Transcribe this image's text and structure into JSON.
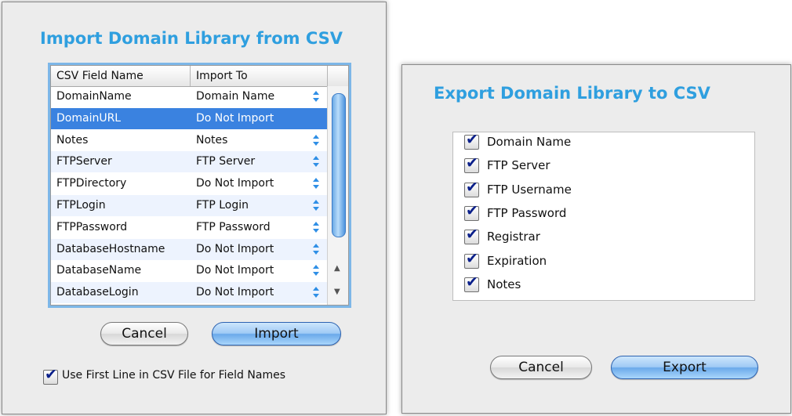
{
  "import_dialog": {
    "title": "Import Domain Library from CSV",
    "columns": [
      "CSV Field Name",
      "Import To"
    ],
    "rows": [
      {
        "field": "DomainName",
        "import_to": "Domain Name"
      },
      {
        "field": "DomainURL",
        "import_to": "Do Not Import"
      },
      {
        "field": "Notes",
        "import_to": "Notes"
      },
      {
        "field": "FTPServer",
        "import_to": "FTP Server"
      },
      {
        "field": "FTPDirectory",
        "import_to": "Do Not Import"
      },
      {
        "field": "FTPLogin",
        "import_to": "FTP Login"
      },
      {
        "field": "FTPPassword",
        "import_to": "FTP Password"
      },
      {
        "field": "DatabaseHostname",
        "import_to": "Do Not Import"
      },
      {
        "field": "DatabaseName",
        "import_to": "Do Not Import"
      },
      {
        "field": "DatabaseLogin",
        "import_to": "Do Not Import"
      }
    ],
    "selected_row": 1,
    "cancel_label": "Cancel",
    "import_label": "Import",
    "first_line_label": "Use First Line in CSV File for Field Names",
    "first_line_checked": true
  },
  "export_dialog": {
    "title": "Export Domain Library to CSV",
    "fields": [
      {
        "label": "Domain Name",
        "checked": true
      },
      {
        "label": "FTP Server",
        "checked": true
      },
      {
        "label": "FTP Username",
        "checked": true
      },
      {
        "label": "FTP Password",
        "checked": true
      },
      {
        "label": "Registrar",
        "checked": true
      },
      {
        "label": "Expiration",
        "checked": true
      },
      {
        "label": "Notes",
        "checked": true
      }
    ],
    "cancel_label": "Cancel",
    "export_label": "Export"
  },
  "colors": {
    "title": "#2f9fdf",
    "selection": "#3a82e0",
    "alt_row": "#edf3fe",
    "check": "#0a1f8a"
  }
}
